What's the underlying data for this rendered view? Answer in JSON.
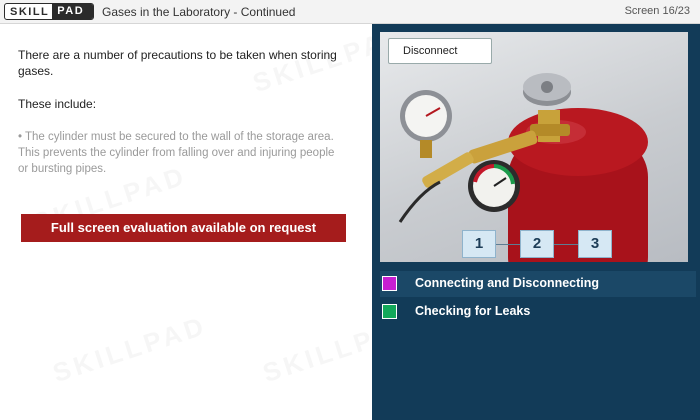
{
  "header": {
    "logo_left": "SKILL",
    "logo_right": "PAD",
    "title": "Gases in the Laboratory - Continued",
    "screen": "Screen 16/23"
  },
  "content": {
    "intro": "There are a number of precautions to be taken when storing gases.",
    "these_include": "These include:",
    "bullet": "• The cylinder must be secured to the wall of the storage area. This prevents the cylinder from falling over and injuring people or bursting pipes.",
    "eval_button": "Full screen evaluation available on request"
  },
  "watermark": "SKILLPAD",
  "media": {
    "disconnect_button": "Disconnect",
    "steps": [
      "1",
      "2",
      "3"
    ]
  },
  "legend": [
    {
      "label": "Connecting and Disconnecting",
      "color": "#c71fd1"
    },
    {
      "label": "Checking for Leaks",
      "color": "#13a85a"
    }
  ],
  "colors": {
    "panel_bg": "#123b58",
    "eval_button": "#a51c1c",
    "cylinder_red": "#b0141c"
  }
}
